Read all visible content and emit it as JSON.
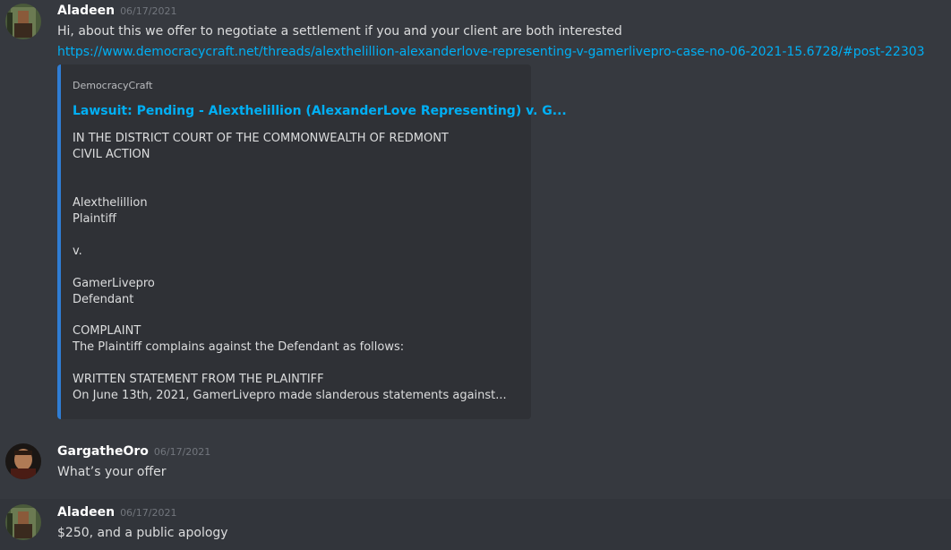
{
  "messages": [
    {
      "author": "Aladeen",
      "timestamp": "06/17/2021",
      "text": "Hi, about this we offer to  negotiate a settlement if you and your client are both interested",
      "link": "https://www.democracycraft.net/threads/alexthelillion-alexanderlove-representing-v-gamerlivepro-case-no-06-2021-15.6728/#post-22303",
      "embed": {
        "provider": "DemocracyCraft",
        "title": "Lawsuit: Pending - Alexthelillion (AlexanderLove Representing) v. G...",
        "lines": [
          "IN THE DISTRICT COURT OF THE COMMONWEALTH OF REDMONT",
          "CIVIL ACTION",
          "Alexthelillion",
          "Plaintiff",
          "v.",
          "GamerLivepro",
          "Defendant",
          "COMPLAINT",
          "The Plaintiff complains against the Defendant as follows:",
          "WRITTEN STATEMENT FROM THE PLAINTIFF",
          "On June 13th, 2021, GamerLivepro made slanderous statements against..."
        ]
      }
    },
    {
      "author": "GargatheOro",
      "timestamp": "06/17/2021",
      "text": "What’s your offer"
    },
    {
      "author": "Aladeen",
      "timestamp": "06/17/2021",
      "text": "$250, and a public apology"
    }
  ]
}
